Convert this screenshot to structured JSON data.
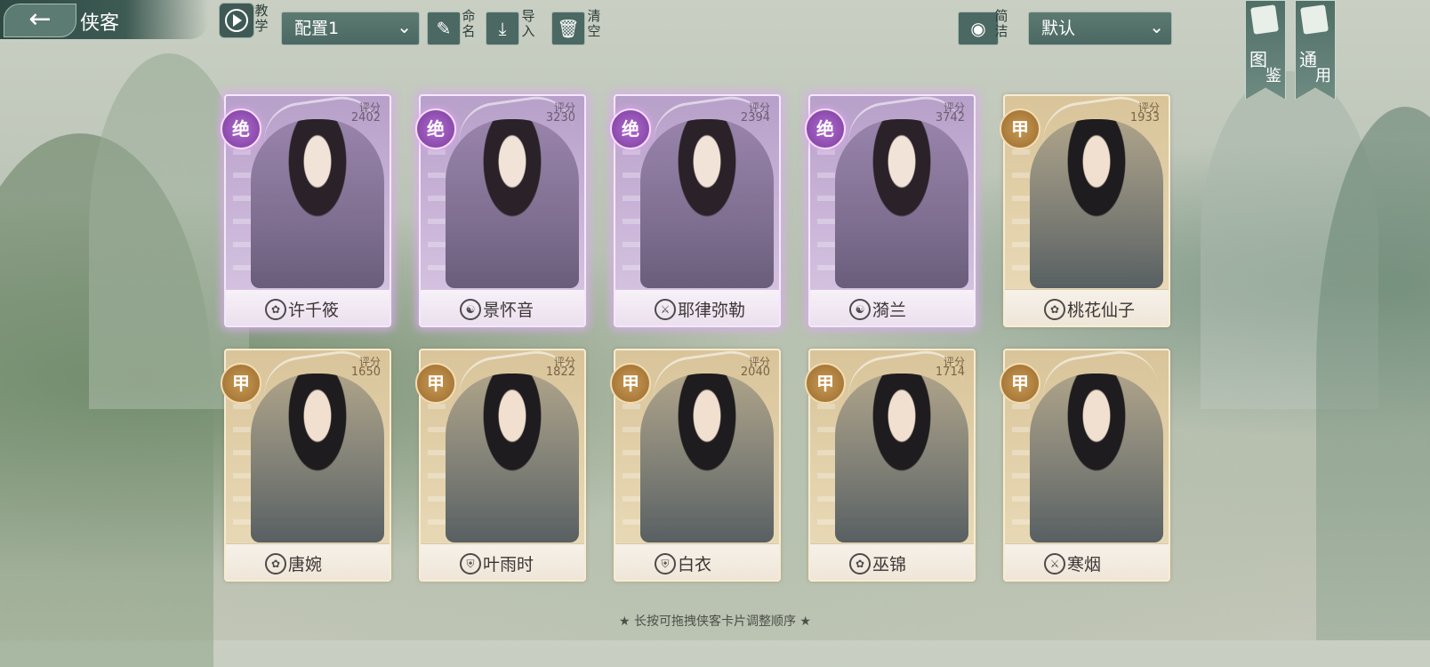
{
  "header": {
    "title": "侠客",
    "tutorial_label": "教学",
    "config_value": "配置1",
    "rename_label": "命名",
    "import_label": "导入",
    "clear_label": "清空",
    "simple_label": "简洁",
    "sort_value": "默认",
    "atlas_label_1": "图",
    "atlas_label_2": "鉴",
    "general_label_1": "通",
    "general_label_2": "用"
  },
  "icons": {
    "back": "←",
    "chevron": "⌄",
    "brush": "✎",
    "import": "⤓",
    "trash": "🗑",
    "eye": "◉"
  },
  "cards": [
    {
      "rank": "绝",
      "score_label": "评分",
      "score": "2402",
      "name": "许千筱",
      "class_icon": "✿"
    },
    {
      "rank": "绝",
      "score_label": "评分",
      "score": "3230",
      "name": "景怀音",
      "class_icon": "☯"
    },
    {
      "rank": "绝",
      "score_label": "评分",
      "score": "2394",
      "name": "耶律弥勒",
      "class_icon": "⚔"
    },
    {
      "rank": "绝",
      "score_label": "评分",
      "score": "3742",
      "name": "漪兰",
      "class_icon": "☯"
    },
    {
      "rank": "甲",
      "score_label": "评分",
      "score": "1933",
      "name": "桃花仙子",
      "class_icon": "✿"
    },
    {
      "rank": "甲",
      "score_label": "评分",
      "score": "1650",
      "name": "唐婉",
      "class_icon": "✿"
    },
    {
      "rank": "甲",
      "score_label": "评分",
      "score": "1822",
      "name": "叶雨时",
      "class_icon": "⛨"
    },
    {
      "rank": "甲",
      "score_label": "评分",
      "score": "2040",
      "name": "白衣",
      "class_icon": "⛨"
    },
    {
      "rank": "甲",
      "score_label": "评分",
      "score": "1714",
      "name": "巫锦",
      "class_icon": "✿"
    },
    {
      "rank": "甲",
      "score_label": "",
      "score": "",
      "name": "寒烟",
      "class_icon": "⚔"
    }
  ],
  "footer_hint": "★ 长按可拖拽侠客卡片调整顺序 ★"
}
